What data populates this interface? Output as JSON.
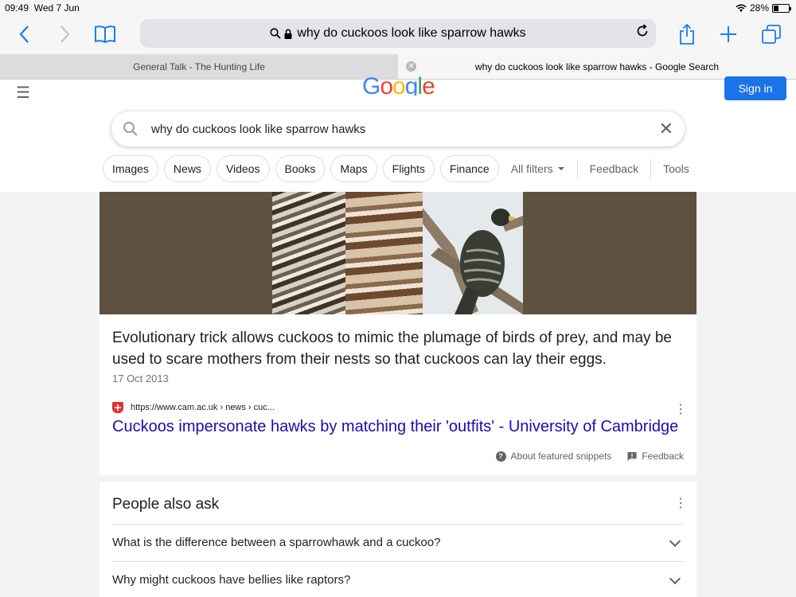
{
  "status_bar": {
    "time": "09:49",
    "date": "Wed 7 Jun",
    "battery_text": "28%",
    "battery_level": 0.28
  },
  "browser": {
    "url_text": "why do cuckoos look like sparrow hawks",
    "accent_color": "#1a7cf2",
    "tabs": [
      {
        "label": "General Talk - The Hunting Life"
      },
      {
        "label": "why do cuckoos look like sparrow hawks - Google Search"
      }
    ]
  },
  "google": {
    "logo_text": "Google",
    "sign_in_label": "Sign in",
    "query": "why do cuckoos look like sparrow hawks",
    "chips": [
      "Images",
      "News",
      "Videos",
      "Books",
      "Maps",
      "Flights",
      "Finance"
    ],
    "all_filters_label": "All filters",
    "feedback_label": "Feedback",
    "tools_label": "Tools"
  },
  "featured_snippet": {
    "description": "Evolutionary trick allows cuckoos to mimic the plumage of birds of prey, and may be used to scare mothers from their nests so that cuckoos can lay their eggs.",
    "date": "17 Oct 2013",
    "source_url": "https://www.cam.ac.uk › news › cuc...",
    "link_title": "Cuckoos impersonate hawks by matching their 'outfits' - University of Cambridge",
    "about_label": "About featured snippets",
    "feedback_label": "Feedback"
  },
  "people_also_ask": {
    "title": "People also ask",
    "questions": [
      "What is the difference between a sparrowhawk and a cuckoo?",
      "Why might cuckoos have bellies like raptors?"
    ]
  }
}
